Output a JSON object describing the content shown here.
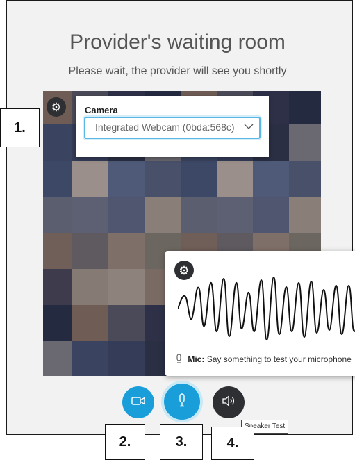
{
  "room": {
    "title": "Provider's waiting room",
    "subtitle": "Please wait, the provider will see you shortly"
  },
  "camera": {
    "label": "Camera",
    "selected": "Integrated Webcam (0bda:568c)"
  },
  "mic": {
    "label": "Mic:",
    "prompt": "Say something to test your microphone"
  },
  "controls": {
    "camera_icon": "camera-icon",
    "mic_icon": "microphone-icon",
    "speaker_icon": "speaker-icon",
    "speaker_tooltip": "Speaker Test",
    "accent": "#1a9ed9",
    "dark": "#2d2f33"
  },
  "callouts": [
    "1.",
    "2.",
    "3.",
    "4."
  ]
}
